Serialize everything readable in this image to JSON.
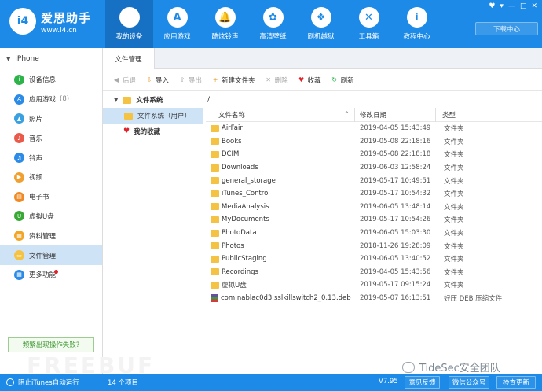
{
  "app": {
    "brand_name": "爱思助手",
    "brand_url": "www.i4.cn",
    "logo_text": "i4"
  },
  "nav": [
    {
      "label": "我的设备",
      "icon": "apple-icon",
      "glyph": "",
      "active": true
    },
    {
      "label": "应用游戏",
      "icon": "app-store-icon",
      "glyph": "A"
    },
    {
      "label": "酷炫铃声",
      "icon": "bell-icon",
      "glyph": "🔔"
    },
    {
      "label": "高清壁纸",
      "icon": "flower-icon",
      "glyph": "✿"
    },
    {
      "label": "刷机越狱",
      "icon": "dropbox-icon",
      "glyph": "❖"
    },
    {
      "label": "工具箱",
      "icon": "tools-icon",
      "glyph": "✕"
    },
    {
      "label": "教程中心",
      "icon": "info-icon",
      "glyph": "i"
    }
  ],
  "window_controls": [
    "♥",
    "▾",
    "—",
    "□",
    "✕"
  ],
  "download_center": "下载中心",
  "sidebar": {
    "device": "iPhone",
    "items": [
      {
        "label": "设备信息",
        "icon": "device-info-icon",
        "color": "#2eb34a",
        "glyph": "i"
      },
      {
        "label": "应用游戏",
        "icon": "apps-icon",
        "color": "#2c8be6",
        "glyph": "A",
        "count": "(8)"
      },
      {
        "label": "照片",
        "icon": "photo-icon",
        "color": "#3aa0e0",
        "glyph": "▲"
      },
      {
        "label": "音乐",
        "icon": "music-icon",
        "color": "#ea5a4b",
        "glyph": "♪"
      },
      {
        "label": "铃声",
        "icon": "ringtone-icon",
        "color": "#2c8be6",
        "glyph": "♫"
      },
      {
        "label": "视频",
        "icon": "video-icon",
        "color": "#f0a030",
        "glyph": "▶"
      },
      {
        "label": "电子书",
        "icon": "ebook-icon",
        "color": "#f08a24",
        "glyph": "▤"
      },
      {
        "label": "虚拟U盘",
        "icon": "usb-icon",
        "color": "#39a935",
        "glyph": "U"
      },
      {
        "label": "资料管理",
        "icon": "data-manage-icon",
        "color": "#f3a526",
        "glyph": "▦"
      },
      {
        "label": "文件管理",
        "icon": "file-manage-icon",
        "color": "#f5c343",
        "glyph": "▭",
        "active": true
      },
      {
        "label": "更多功能",
        "icon": "more-icon",
        "color": "#2c8be6",
        "glyph": "▦",
        "dot": true
      }
    ],
    "help_button": "频繁出现操作失败?"
  },
  "tabs": [
    {
      "label": "文件管理"
    }
  ],
  "toolbar": [
    {
      "label": "后退",
      "icon": "back-icon",
      "glyph": "◀",
      "disabled": true
    },
    {
      "label": "导入",
      "icon": "import-icon",
      "glyph": "⇩",
      "disabled": false
    },
    {
      "label": "导出",
      "icon": "export-icon",
      "glyph": "⇧",
      "disabled": true
    },
    {
      "label": "新建文件夹",
      "icon": "new-folder-icon",
      "glyph": "+",
      "disabled": false
    },
    {
      "label": "删除",
      "icon": "delete-icon",
      "glyph": "✕",
      "disabled": true
    },
    {
      "label": "收藏",
      "icon": "favorite-icon",
      "glyph": "♥",
      "disabled": false
    },
    {
      "label": "刷新",
      "icon": "refresh-icon",
      "glyph": "↻",
      "disabled": false
    }
  ],
  "tree": [
    {
      "label": "文件系统",
      "level": 0,
      "type": "folder",
      "expand": "▼"
    },
    {
      "label": "文件系统（用户）",
      "level": 1,
      "type": "folder",
      "selected": true
    },
    {
      "label": "我的收藏",
      "level": 0,
      "type": "favorite"
    }
  ],
  "path": "/",
  "columns": {
    "name": "文件名称",
    "date": "修改日期",
    "type": "类型",
    "sort_glyph": "^"
  },
  "files": [
    {
      "name": "AirFair",
      "date": "2019-04-05 15:43:49",
      "type": "文件夹",
      "kind": "folder"
    },
    {
      "name": "Books",
      "date": "2019-05-08 22:18:16",
      "type": "文件夹",
      "kind": "folder"
    },
    {
      "name": "DCIM",
      "date": "2019-05-08 22:18:18",
      "type": "文件夹",
      "kind": "folder"
    },
    {
      "name": "Downloads",
      "date": "2019-06-03 12:58:24",
      "type": "文件夹",
      "kind": "folder"
    },
    {
      "name": "general_storage",
      "date": "2019-05-17 10:49:51",
      "type": "文件夹",
      "kind": "folder"
    },
    {
      "name": "iTunes_Control",
      "date": "2019-05-17 10:54:32",
      "type": "文件夹",
      "kind": "folder"
    },
    {
      "name": "MediaAnalysis",
      "date": "2019-06-05 13:48:14",
      "type": "文件夹",
      "kind": "folder"
    },
    {
      "name": "MyDocuments",
      "date": "2019-05-17 10:54:26",
      "type": "文件夹",
      "kind": "folder"
    },
    {
      "name": "PhotoData",
      "date": "2019-06-05 15:03:30",
      "type": "文件夹",
      "kind": "folder"
    },
    {
      "name": "Photos",
      "date": "2018-11-26 19:28:09",
      "type": "文件夹",
      "kind": "folder"
    },
    {
      "name": "PublicStaging",
      "date": "2019-06-05 13:40:52",
      "type": "文件夹",
      "kind": "folder"
    },
    {
      "name": "Recordings",
      "date": "2019-04-05 15:43:56",
      "type": "文件夹",
      "kind": "folder"
    },
    {
      "name": "虚拟U盘",
      "date": "2019-05-17 09:15:24",
      "type": "文件夹",
      "kind": "folder"
    },
    {
      "name": "com.nablac0d3.sslkillswitch2_0.13.deb",
      "date": "2019-05-07 16:13:51",
      "type": "好压 DEB 压缩文件",
      "kind": "archive"
    }
  ],
  "status": {
    "itunes_check": "阻止iTunes自动运行",
    "item_count": "14 个项目",
    "version": "V7.95",
    "feedback": "意见反馈",
    "wechat": "微信公众号",
    "update": "检查更新"
  },
  "watermark": "TideSec安全团队",
  "faint_watermark": "FREEBUF"
}
